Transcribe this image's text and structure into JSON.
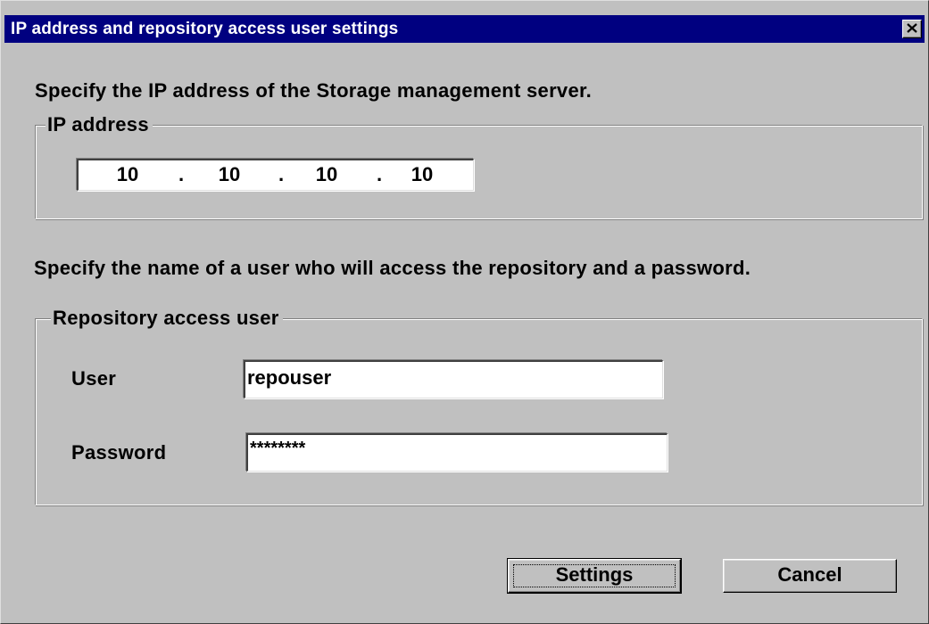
{
  "window": {
    "title": "IP address and repository access user settings"
  },
  "ip_section": {
    "instruction": "Specify the IP address of the Storage management server.",
    "group_label": "IP address",
    "octets": [
      "10",
      "10",
      "10",
      "10"
    ]
  },
  "repo_section": {
    "instruction": "Specify the name of a user who will access the repository and a password.",
    "group_label": "Repository access user",
    "user_label": "User",
    "user_value": "repouser",
    "password_label": "Password",
    "password_value": "********"
  },
  "buttons": {
    "settings_label": "Settings",
    "cancel_label": "Cancel"
  },
  "icons": {
    "close": "close-icon"
  }
}
